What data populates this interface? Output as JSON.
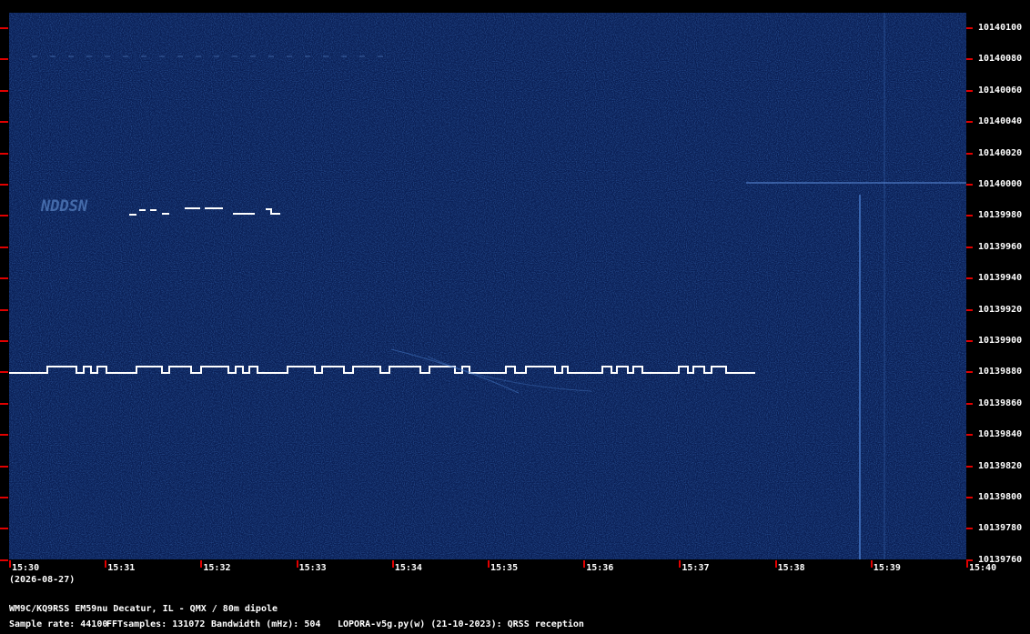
{
  "waterfall": {
    "freq_labels": [
      "10140100",
      "10140080",
      "10140060",
      "10140040",
      "10140020",
      "10140000",
      "10139980",
      "10139960",
      "10139940",
      "10139920",
      "10139900",
      "10139880",
      "10139860",
      "10139840",
      "10139820",
      "10139800",
      "10139780",
      "10139760"
    ],
    "time_labels": [
      "15:30",
      "15:31",
      "15:32",
      "15:33",
      "15:34",
      "15:35",
      "15:36",
      "15:37",
      "15:38",
      "15:39",
      "15:40"
    ],
    "date_label": "(2026-08-27)",
    "decoded_text": "NDDSN",
    "colors": {
      "background": "#0a1f55",
      "trace": "#ffffff",
      "tick": "#e00000"
    }
  },
  "footer": {
    "station": "WM9C/KQ9RSS EM59nu Decatur, IL - QMX / 80m dipole",
    "sample_rate": "Sample rate: 44100",
    "fft_samples": "FFTsamples: 131072",
    "bandwidth": "Bandwidth (mHz): 504",
    "software": "LOPORA-v5g.py(w) (21-10-2023): QRSS reception"
  }
}
